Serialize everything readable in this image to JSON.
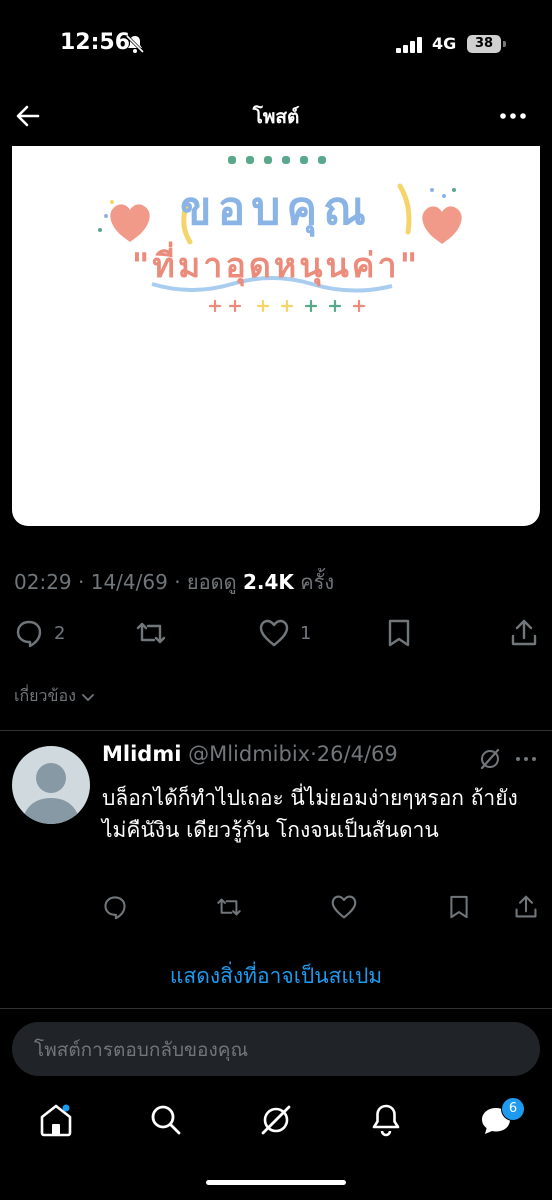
{
  "status_bar": {
    "time": "12:56",
    "network": "4G",
    "battery": "38"
  },
  "header": {
    "title": "โพสต์"
  },
  "post_image": {
    "line1": "ขอบคุณ",
    "line2": "\"ที่มาอุดหนุนค่า\"",
    "colors": {
      "blue": "#8bb4e6",
      "pink": "#ec8b7a",
      "yellow": "#f5d56b",
      "green": "#5aa88a"
    }
  },
  "meta": {
    "time": "02:29",
    "date": "14/4/69",
    "views_label": "ยอดดู",
    "views": "2.4K",
    "views_suffix": "ครั้ง"
  },
  "actions": {
    "replies": "2",
    "likes": "1"
  },
  "related_label": "เกี่ยวข้อง",
  "reply": {
    "name": "Mlidmi",
    "handle": "@Mlidmibix",
    "date": "26/4/69",
    "text": "บล็อกได้ก็ทำไปเถอะ นี่ไม่ยอมง่ายๆหรอก ถ้ายังไม่คืนังิน เดียวรู้กัน โกงจนเป็นสันดาน"
  },
  "spam_link": "แสดงสิ่งที่อาจเป็นสแปม",
  "composer": {
    "placeholder": "โพสต์การตอบกลับของคุณ"
  },
  "nav": {
    "messages_badge": "6"
  },
  "icons": [
    "back-arrow-icon",
    "more-icon",
    "reply-icon",
    "repost-icon",
    "like-icon",
    "bookmark-icon",
    "share-icon",
    "grok-icon",
    "home-icon",
    "search-icon",
    "bell-icon",
    "messages-icon"
  ]
}
